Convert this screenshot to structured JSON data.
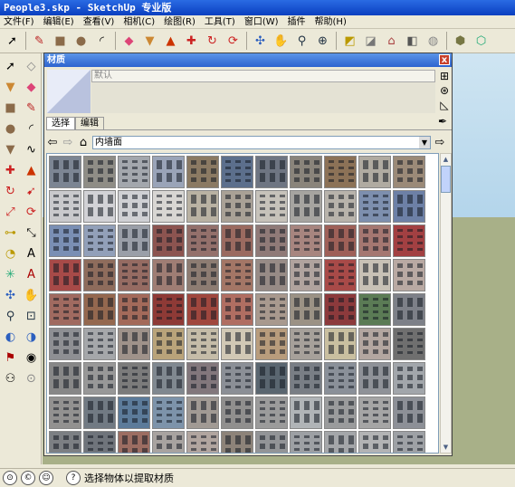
{
  "window": {
    "title": "People3.skp - SketchUp 专业版"
  },
  "menu": [
    "文件(F)",
    "编辑(E)",
    "查看(V)",
    "相机(C)",
    "绘图(R)",
    "工具(T)",
    "窗口(W)",
    "插件",
    "帮助(H)"
  ],
  "toolbar_icons": [
    "select-icon",
    "pencil-icon",
    "rectangle-icon",
    "circle-icon",
    "arc-icon",
    "eraser-icon",
    "paint-bucket-icon",
    "push-pull-icon",
    "move-icon",
    "rotate-icon",
    "offset-icon",
    "tape-measure-icon",
    "orbit-icon",
    "pan-icon",
    "zoom-icon",
    "zoom-extents-icon",
    "section-icon",
    "iso-view-icon",
    "top-view-icon",
    "front-view-icon",
    "component-icon",
    "sandbox-icon"
  ],
  "materials_panel": {
    "title": "材质",
    "name_placeholder": "默认",
    "tabs": [
      "选择",
      "编辑"
    ],
    "library": "内墙面",
    "close_label": "x"
  },
  "status": {
    "hint": "选择物体以提取材质"
  },
  "palette": [
    "#7c8593",
    "#8f8d86",
    "#a3a7ad",
    "#9aa4b8",
    "#8b7a63",
    "#5c6f8c",
    "#6e7582",
    "#8a847b",
    "#8c7257",
    "#b0aba1",
    "#9b8a78",
    "#c9c9cc",
    "#d2d2d6",
    "#cfd0d4",
    "#d8d6d3",
    "#b9b2a3",
    "#a9a196",
    "#c6c2ba",
    "#a6a4a0",
    "#b8b3ab",
    "#7d8fae",
    "#6d80a6",
    "#7a8fb4",
    "#92a0b9",
    "#9a9fa8",
    "#8c5450",
    "#93706b",
    "#9a6a60",
    "#8f7a78",
    "#a7857f",
    "#9e6058",
    "#a57771",
    "#a24042",
    "#a74a48",
    "#8e6c5c",
    "#956b62",
    "#9f7d74",
    "#8d7c72",
    "#a37666",
    "#978b86",
    "#b0a39e",
    "#a84a48",
    "#c8c1b6",
    "#b9a9a3",
    "#a06a60",
    "#94684f",
    "#a36a5a",
    "#8e3a36",
    "#a0473e",
    "#b06e62",
    "#a8998e",
    "#9b9285",
    "#8c3a3c",
    "#5b7b55",
    "#7d8088",
    "#8e8f93",
    "#a5a7aa",
    "#9f928a",
    "#b9a37a",
    "#c5bca8",
    "#d1c8b5",
    "#b89c7c",
    "#a6a09a",
    "#c9bfa0",
    "#b3a6a0",
    "#6f6f6f",
    "#878787",
    "#989898",
    "#7b7b7b",
    "#808890",
    "#82777c",
    "#8b8f96",
    "#5a6670",
    "#797e85",
    "#8a9099",
    "#8f9298",
    "#a2a6ab",
    "#929190",
    "#717a83",
    "#5c7b9a",
    "#7d93aa",
    "#a19a94",
    "#908f8e",
    "#9b9b9b",
    "#b0b4b7",
    "#9a9b9c",
    "#a5a5a5",
    "#8d9097",
    "#7c7f83",
    "#6f747b",
    "#9c6d62",
    "#a8a3a0",
    "#b1a59f",
    "#8d8379",
    "#929497",
    "#9da0a4",
    "#a4a6a9",
    "#b2b3b4",
    "#9ea1a5",
    "#8f9297",
    "#9a9da1",
    "#a2a5a8"
  ]
}
